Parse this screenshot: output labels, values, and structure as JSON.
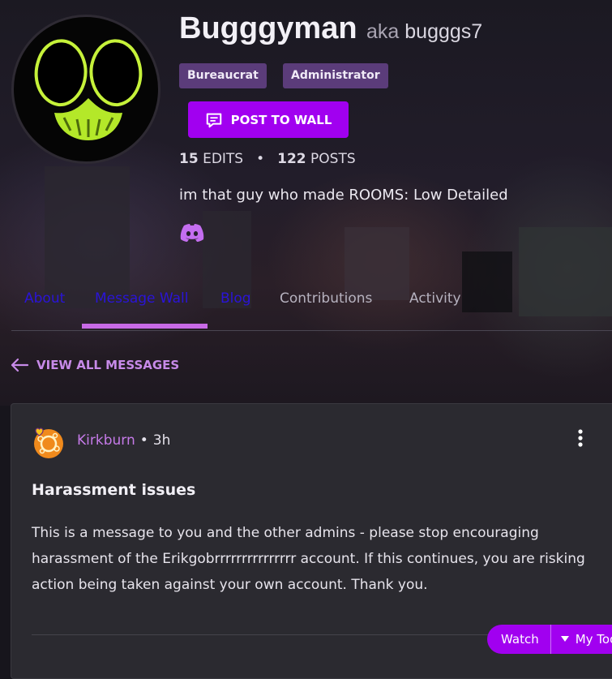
{
  "profile": {
    "username": "Bugggyman",
    "aka_label": "aka",
    "aka_name": "bugggs7",
    "tags": [
      "Bureaucrat",
      "Administrator"
    ],
    "post_to_wall_label": "POST TO WALL",
    "edits_count": "15",
    "edits_label": "EDITS",
    "stats_separator": "•",
    "posts_count": "122",
    "posts_label": "POSTS",
    "bio": "im that guy who made ROOMS: Low Detailed",
    "social_icon": "discord-icon"
  },
  "tabs": [
    {
      "label": "About",
      "state": "link"
    },
    {
      "label": "Message Wall",
      "state": "active-link"
    },
    {
      "label": "Blog",
      "state": "link"
    },
    {
      "label": "Contributions",
      "state": "normal"
    },
    {
      "label": "Activity",
      "state": "normal"
    }
  ],
  "back_link": {
    "label": "VIEW ALL MESSAGES",
    "icon": "arrow-left-icon"
  },
  "message": {
    "author": "Kirkburn",
    "separator": "•",
    "time": "3h",
    "title": "Harassment issues",
    "body": "This is a message to you and the other admins - please stop encouraging harassment of the Erikgobrrrrrrrrrrrrrrr account. If this continues, you are risking action being taken against your own account. Thank you."
  },
  "toolbar": {
    "watch_label": "Watch",
    "tools_label": "My Too"
  },
  "colors": {
    "accent": "#a100f0",
    "tag_bg": "#5b3c7a",
    "link_purple": "#c57ae8",
    "tab_link": "#2a14d8",
    "card_bg": "#2b2a30",
    "avatar_glow": "#c6f23a"
  }
}
